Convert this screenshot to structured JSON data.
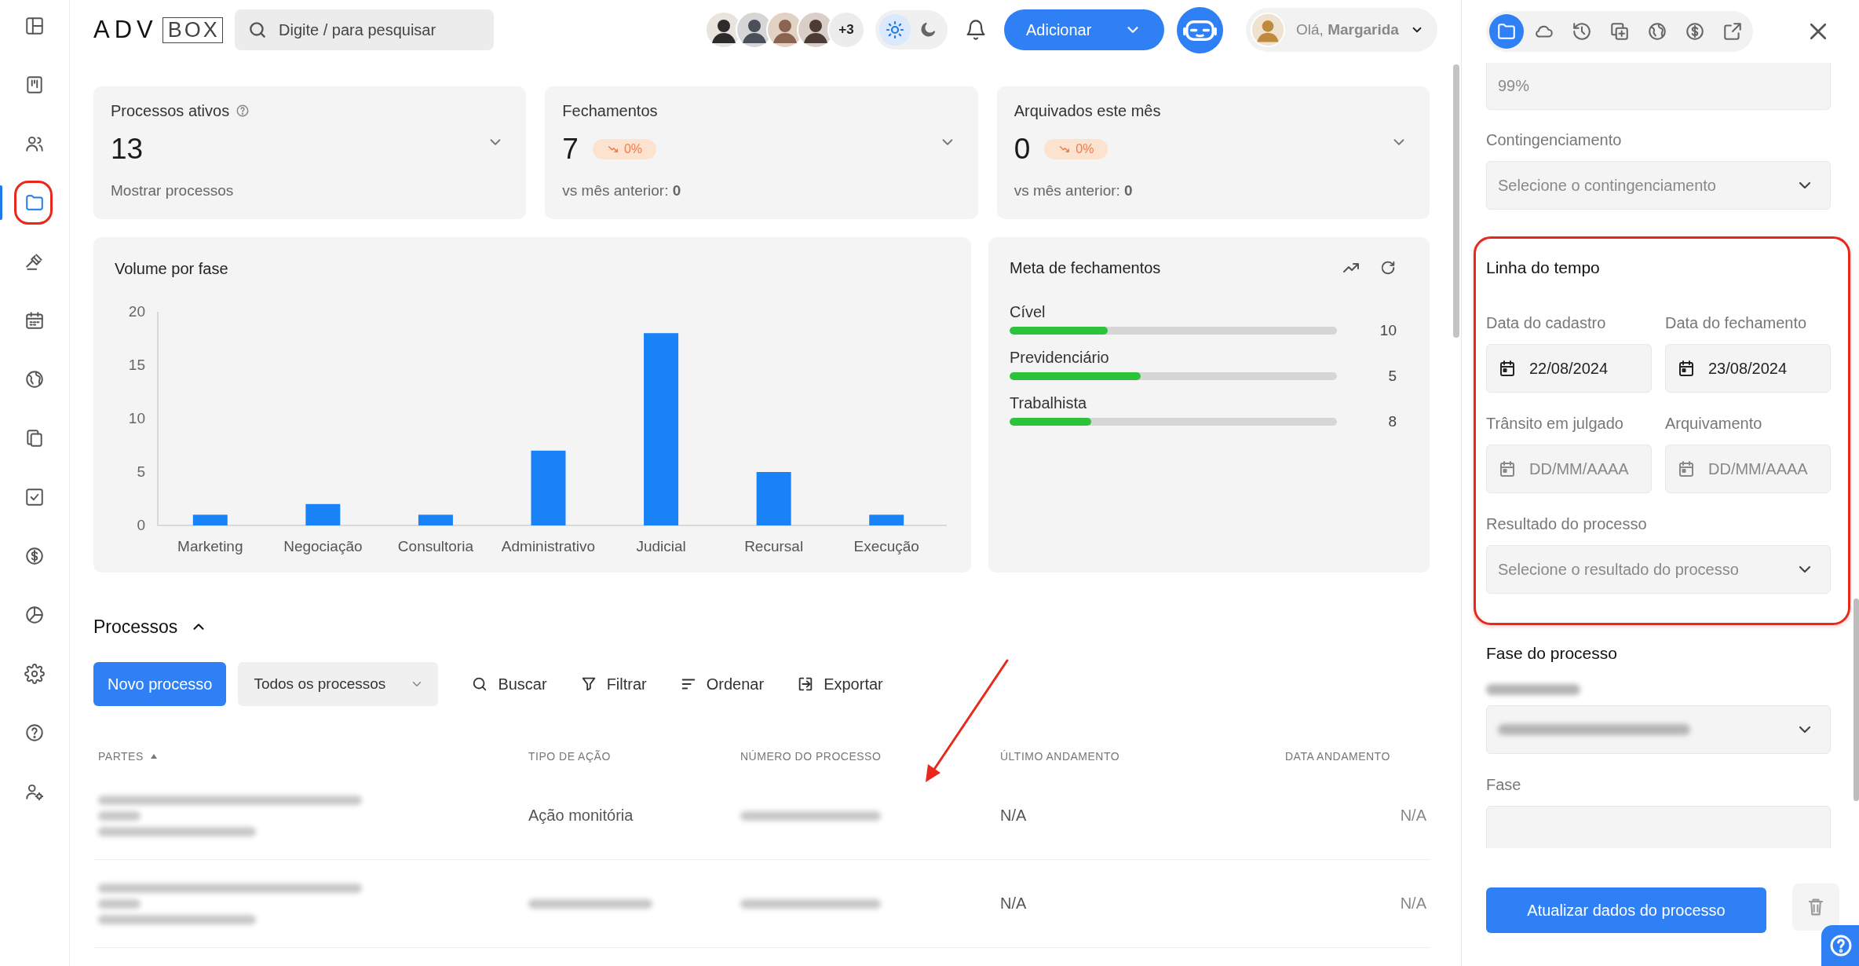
{
  "sidebar": {
    "items": [
      {
        "selected": false,
        "highlighted": false
      },
      {
        "selected": false,
        "highlighted": false
      },
      {
        "selected": false,
        "highlighted": false
      },
      {
        "selected": true,
        "highlighted": true
      },
      {
        "selected": false,
        "highlighted": false
      },
      {
        "selected": false,
        "highlighted": false
      },
      {
        "selected": false,
        "highlighted": false
      },
      {
        "selected": false,
        "highlighted": false
      },
      {
        "selected": false,
        "highlighted": false
      },
      {
        "selected": false,
        "highlighted": false
      },
      {
        "selected": false,
        "highlighted": false
      },
      {
        "selected": false,
        "highlighted": false
      },
      {
        "selected": false,
        "highlighted": false
      },
      {
        "selected": false,
        "highlighted": false
      }
    ]
  },
  "top_bar": {
    "logo": {
      "left": "ADV",
      "right": "BOX"
    },
    "search": {
      "placeholder": "Digite / para pesquisar"
    },
    "avatars": {
      "more": "+3"
    },
    "theme_options": [
      {
        "selected": true
      },
      {
        "selected": false
      }
    ],
    "add_button": "Adicionar",
    "user": {
      "greeting": "Olá, **Margarida**"
    }
  },
  "stats": [
    {
      "title": "Processos ativos",
      "help": true,
      "value": "13",
      "footer": "Mostrar processos"
    },
    {
      "title": "Fechamentos",
      "help": false,
      "value": "7",
      "badge": "0%",
      "footer": "vs mês anterior: **0**"
    },
    {
      "title": "Arquivados este mês",
      "help": false,
      "value": "0",
      "badge": "0%",
      "footer": "vs mês anterior: **0**"
    }
  ],
  "volume": {
    "title": "Volume por fase",
    "chart_data": {
      "type": "bar",
      "categories": [
        "Marketing",
        "Negociação",
        "Consultoria",
        "Administrativo",
        "Judicial",
        "Recursal",
        "Execução"
      ],
      "values": [
        1,
        2,
        1,
        7,
        18,
        5,
        1
      ],
      "ylim": [
        0,
        20
      ],
      "yticks": [
        0,
        5,
        10,
        15,
        20
      ]
    }
  },
  "meta": {
    "title": "Meta de fechamentos",
    "rows": [
      {
        "label": "Cível",
        "level": 0.3,
        "reading": "10"
      },
      {
        "label": "Previdenciário",
        "level": 0.4,
        "reading": "5"
      },
      {
        "label": "Trabalhista",
        "level": 0.25,
        "reading": "8"
      }
    ]
  },
  "processos": {
    "title": "Processos",
    "expanded": true,
    "new_button": "Novo processo",
    "filter_select": "Todos os processos",
    "actions": [
      "Buscar",
      "Filtrar",
      "Ordenar",
      "Exportar"
    ],
    "table": {
      "columns": [
        {
          "label": "PARTES",
          "sorted": true
        },
        {
          "label": "TIPO DE AÇÃO",
          "sorted": false
        },
        {
          "label": "NÚMERO DO PROCESSO",
          "sorted": false
        },
        {
          "label": "ÚLTIMO ANDAMENTO",
          "sorted": false
        },
        {
          "label": "DATA ANDAMENTO",
          "sorted": false
        }
      ],
      "rows": [
        {
          "cells": [
            {
              "blurred": true
            },
            {
              "text": "Ação monitória"
            },
            {
              "blurred": true
            },
            {
              "text": "N/A"
            },
            {
              "text": "N/A"
            }
          ]
        },
        {
          "cells": [
            {
              "blurred": true
            },
            {
              "blurred": true
            },
            {
              "blurred": true
            },
            {
              "text": "N/A"
            },
            {
              "text": "N/A"
            }
          ]
        }
      ]
    }
  },
  "side_panel": {
    "tabs": [
      {
        "selected": true
      },
      {
        "selected": false
      },
      {
        "selected": false
      },
      {
        "selected": false
      },
      {
        "selected": false
      },
      {
        "selected": false
      },
      {
        "selected": false
      }
    ],
    "items": [
      {
        "kind": "field",
        "value": "99%"
      },
      {
        "kind": "select",
        "label": "Contingenciamento",
        "placeholder": "Selecione o contingenciamento"
      },
      {
        "kind": "group",
        "title": "Linha do tempo",
        "highlighted": true,
        "items": [
          {
            "kind": "dates",
            "fields": [
              {
                "label": "Data do cadastro",
                "value": "22/08/2024"
              },
              {
                "label": "Data do fechamento",
                "value": "23/08/2024"
              }
            ]
          },
          {
            "kind": "dates",
            "fields": [
              {
                "label": "Trânsito em julgado",
                "placeholder": "DD/MM/AAAA"
              },
              {
                "label": "Arquivamento",
                "placeholder": "DD/MM/AAAA"
              }
            ]
          },
          {
            "kind": "select",
            "label": "Resultado do processo",
            "placeholder": "Selecione o resultado do processo"
          }
        ]
      },
      {
        "kind": "group",
        "title": "Fase do processo",
        "highlighted": false,
        "items": [
          {
            "kind": "blurred_select"
          },
          {
            "kind": "field",
            "label": "Fase"
          }
        ]
      }
    ],
    "submit": "Atualizar dados do processo"
  },
  "annotations": [
    {
      "kind": "arrow"
    }
  ]
}
